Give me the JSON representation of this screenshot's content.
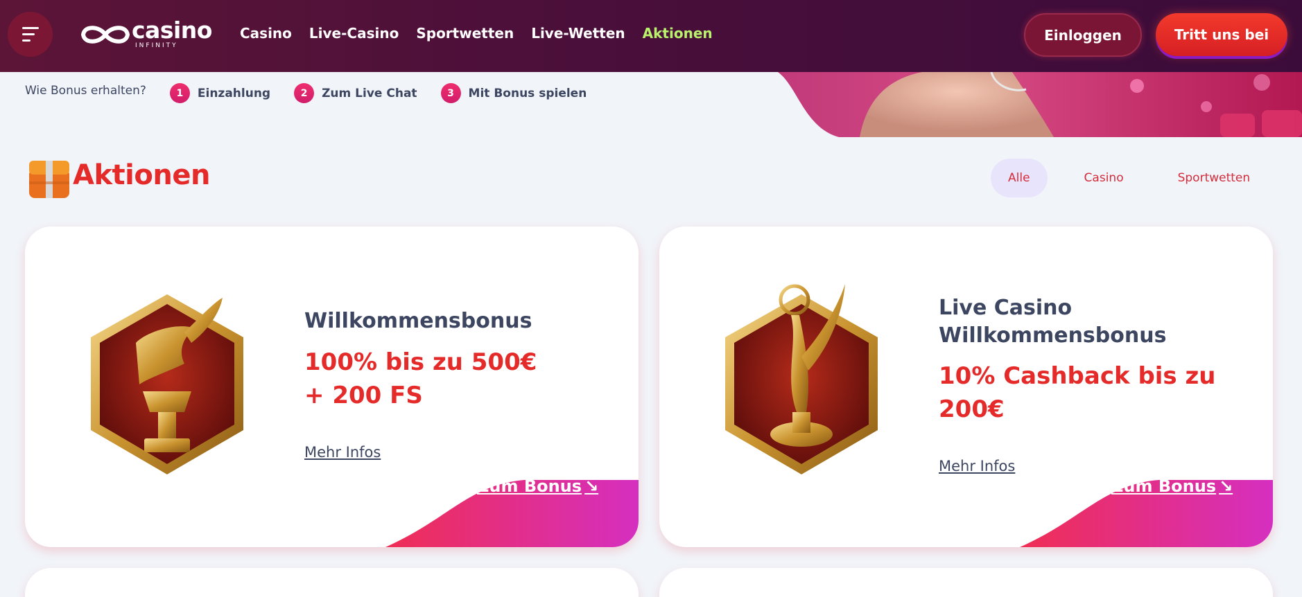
{
  "header": {
    "brand": "casino",
    "brand_sub": "INFINITY",
    "nav": [
      "Casino",
      "Live-Casino",
      "Sportwetten",
      "Live-Wetten",
      "Aktionen"
    ],
    "login_label": "Einloggen",
    "join_label": "Tritt uns bei"
  },
  "steps": {
    "question": "Wie Bonus erhalten?",
    "items": [
      {
        "num": "1",
        "label": "Einzahlung"
      },
      {
        "num": "2",
        "label": "Zum Live Chat"
      },
      {
        "num": "3",
        "label": "Mit Bonus spielen"
      }
    ]
  },
  "section": {
    "title": "Aktionen",
    "filters": [
      "Alle",
      "Casino",
      "Sportwetten"
    ]
  },
  "cards": [
    {
      "title": "Willkommensbonus",
      "offer_line1": "100%  bis zu  500€",
      "offer_line2": "+ 200 FS",
      "more": "Mehr Infos",
      "cta": "Zum Bonus",
      "arrow": "↘"
    },
    {
      "title_line1": "Live Casino",
      "title_line2": "Willkommensbonus",
      "offer_line1": "10%  Cashback bis zu",
      "offer_line2": "200€",
      "more": "Mehr Infos",
      "cta": "Zum Bonus",
      "arrow": "↘"
    }
  ],
  "colors": {
    "header_bg": "#4a0f3a",
    "accent_red": "#e52a2a",
    "nav_active": "#b9f26b",
    "cta_start": "#ef2e54",
    "cta_end": "#d52fc0"
  }
}
